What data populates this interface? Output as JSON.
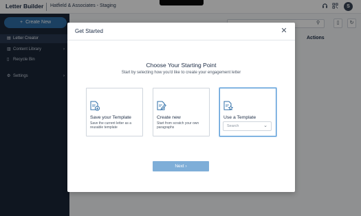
{
  "app": {
    "title": "Letter Builder",
    "org": "Hatfield & Associates - Staging"
  },
  "topbar_icons": [
    "headset-icon",
    "qr-icon"
  ],
  "user": {
    "initial": "S"
  },
  "sidebar": {
    "create_label": "Create New",
    "items": [
      {
        "label": "Letter Creator",
        "icon": "letter-icon",
        "active": true
      },
      {
        "label": "Content Library",
        "icon": "library-icon"
      },
      {
        "label": "Recycle Bin",
        "icon": "trash-icon"
      },
      {
        "label": "Settings",
        "icon": "gear-icon"
      }
    ]
  },
  "background": {
    "table_header_actions": "Actions"
  },
  "modal": {
    "title": "Get Started",
    "heading": "Choose Your Starting Point",
    "subheading": "Start by selecting how you'd like to create your engagement letter",
    "cards": [
      {
        "title": "Save your Template",
        "desc": "Save the current letter as a reusable template"
      },
      {
        "title": "Create new",
        "desc": "Start from scratch your own paragraphs"
      },
      {
        "title": "Use a Template",
        "select_placeholder": "Search"
      }
    ],
    "next_label": "Next"
  },
  "colors": {
    "sidebar_bg": "#1a2638",
    "accent": "#2f6fa8",
    "next_button": "#7eaed8",
    "selected_border": "#5a9bd5"
  }
}
